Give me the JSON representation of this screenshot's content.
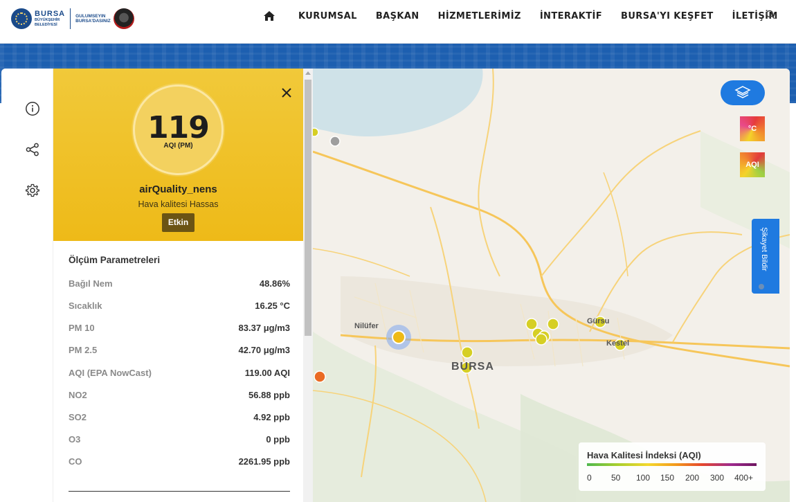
{
  "header": {
    "logo_title": "BURSA",
    "logo_sub1": "BÜYÜKŞEHİR",
    "logo_sub2": "BELEDİYESİ",
    "slogan_line1": "GULUMSEYIN",
    "slogan_line2": "BURSA'DASINIZ",
    "nav": [
      "KURUMSAL",
      "BAŞKAN",
      "HİZMETLERİMİZ",
      "İNTERAKTİF",
      "BURSA'YI KEŞFET",
      "İLETİŞİM"
    ]
  },
  "station": {
    "aqi_value": "119",
    "aqi_unit": "AQI (PM)",
    "name": "airQuality_nens",
    "description": "Hava kalitesi Hassas",
    "status": "Etkin"
  },
  "params": {
    "title": "Ölçüm Parametreleri",
    "rows": [
      {
        "label": "Bağıl Nem",
        "value": "48.86%"
      },
      {
        "label": "Sıcaklık",
        "value": "16.25 °C"
      },
      {
        "label": "PM 10",
        "value": "83.37 μg/m3"
      },
      {
        "label": "PM 2.5",
        "value": "42.70 μg/m3"
      },
      {
        "label": "AQI (EPA NowCast)",
        "value": "119.00 AQI"
      },
      {
        "label": "NO2",
        "value": "56.88 ppb"
      },
      {
        "label": "SO2",
        "value": "4.92 ppb"
      },
      {
        "label": "O3",
        "value": "0 ppb"
      },
      {
        "label": "CO",
        "value": "2261.95 ppb"
      }
    ]
  },
  "map": {
    "layer_tile_1": "°C",
    "layer_tile_2": "AQI",
    "complaint_label": "Şikayet Bildir",
    "city_main": "BURSA",
    "city_nilufer": "Nilüfer",
    "city_gursu": "Gürsu",
    "city_kestel": "Kestel"
  },
  "legend": {
    "title": "Hava Kalitesi İndeksi (AQI)",
    "labels": [
      "0",
      "50",
      "100",
      "150",
      "200",
      "300",
      "400+"
    ]
  },
  "colors": {
    "panel_yellow": "#eeba18",
    "accent_blue": "#1f7ae0",
    "badge_brown": "#6b5414"
  }
}
